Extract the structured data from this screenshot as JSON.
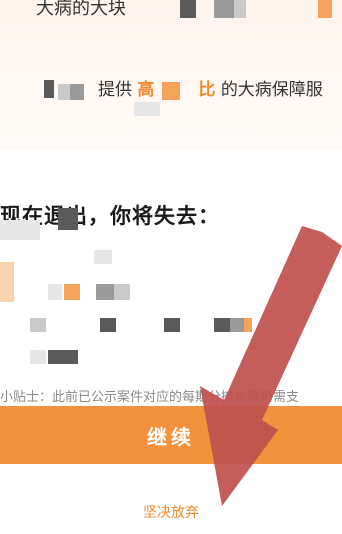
{
  "promo": {
    "line1_text": "大病的大块",
    "line2_prefix": "提供",
    "line2_highlight_start": "高",
    "line2_highlight_end": "比",
    "line2_suffix": "的大病保障服"
  },
  "exit_section": {
    "title": "现在退出，你将失去："
  },
  "tip": {
    "text": "小贴士：此前已公示案件对应的每期分摊金额仍需支"
  },
  "actions": {
    "continue_label": "继续",
    "give_up_label": "坚决放弃"
  },
  "colors": {
    "accent": "#f3913d",
    "arrow": "#c0504d"
  },
  "icons": [
    "arrow-annotation-icon"
  ]
}
